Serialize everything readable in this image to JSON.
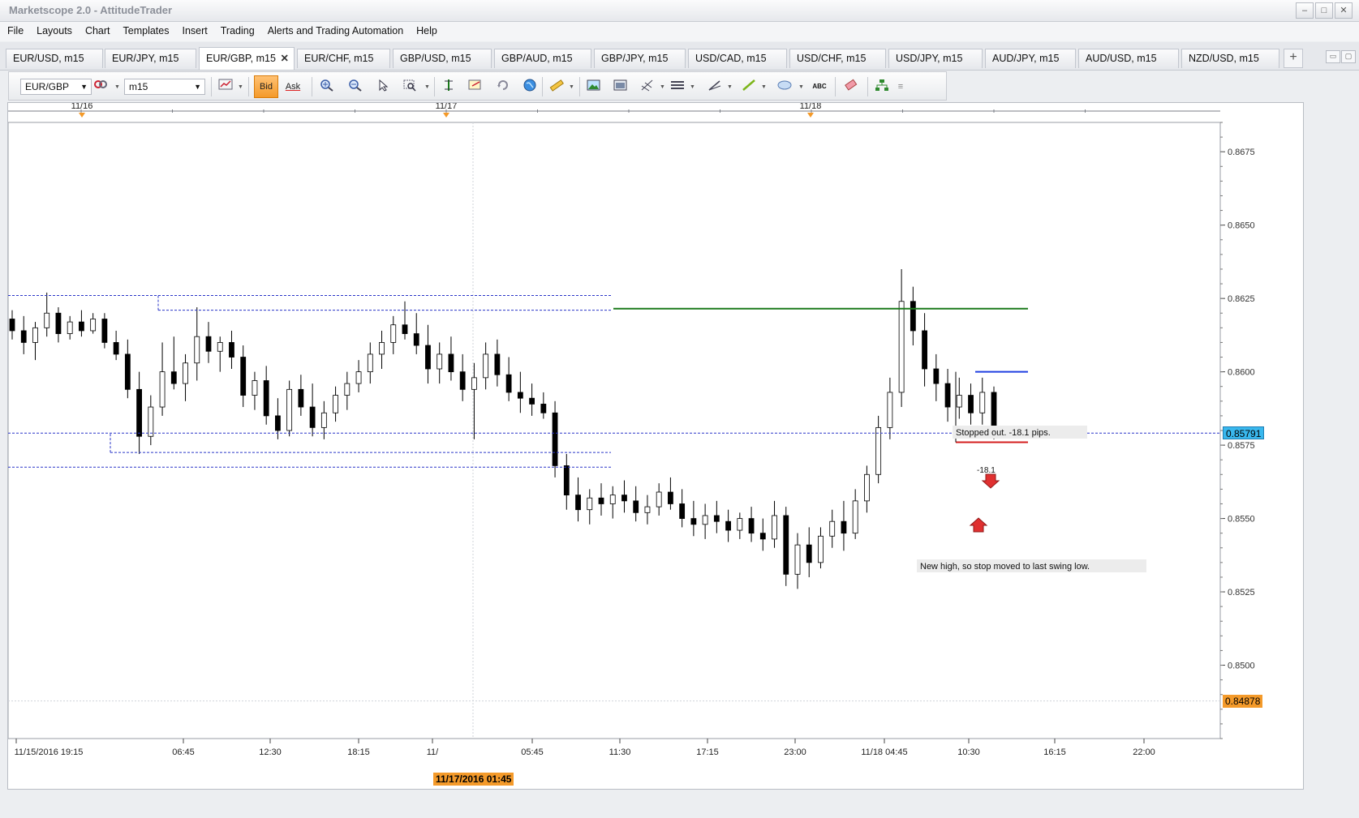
{
  "window": {
    "title": "Marketscope 2.0 - AttitudeTrader",
    "controls": [
      "–",
      "□",
      "✕"
    ]
  },
  "menu": [
    "File",
    "Layouts",
    "Chart",
    "Templates",
    "Insert",
    "Trading",
    "Alerts and Trading Automation",
    "Help"
  ],
  "tabs": [
    {
      "label": "EUR/USD, m15",
      "active": false
    },
    {
      "label": "EUR/JPY, m15",
      "active": false
    },
    {
      "label": "EUR/GBP, m15",
      "active": true
    },
    {
      "label": "EUR/CHF, m15",
      "active": false
    },
    {
      "label": "GBP/USD, m15",
      "active": false
    },
    {
      "label": "GBP/AUD, m15",
      "active": false
    },
    {
      "label": "GBP/JPY, m15",
      "active": false
    },
    {
      "label": "USD/CAD, m15",
      "active": false
    },
    {
      "label": "USD/CHF, m15",
      "active": false
    },
    {
      "label": "USD/JPY, m15",
      "active": false
    },
    {
      "label": "AUD/JPY, m15",
      "active": false
    },
    {
      "label": "AUD/USD, m15",
      "active": false
    },
    {
      "label": "NZD/USD, m15",
      "active": false
    }
  ],
  "tab_close_glyph": "✕",
  "tab_add_glyph": "+",
  "toolbar": {
    "instrument": "EUR/GBP",
    "timeframe": "m15",
    "bid_label": "Bid",
    "ask_label": "Ask",
    "abc_label": "ABC"
  },
  "chart_data": {
    "type": "candlestick",
    "instrument": "EUR/GBP",
    "timeframe": "m15",
    "ylim": [
      0.8475,
      0.8685
    ],
    "y_ticks": [
      "0.8675",
      "0.8650",
      "0.8625",
      "0.8600",
      "0.8575",
      "0.8550",
      "0.8525",
      "0.8500"
    ],
    "y_tick_values": [
      0.8675,
      0.865,
      0.8625,
      0.86,
      0.8575,
      0.855,
      0.8525,
      0.85
    ],
    "date_marks": [
      "11/16",
      "11/17",
      "11/18"
    ],
    "x_ticks": [
      "11/15/2016 19:15",
      "06:45",
      "12:30",
      "18:15",
      "11/",
      "05:45",
      "11:30",
      "17:15",
      "23:00",
      "11/18 04:45",
      "10:30",
      "16:15",
      "22:00"
    ],
    "cursor_time_label": "11/17/2016 01:45",
    "current_price_label": "0.85791",
    "current_price": 0.85791,
    "cursor_price_label": "0.84878",
    "cursor_price": 0.84878,
    "candles": [
      {
        "o": 0.8618,
        "h": 0.8621,
        "l": 0.8611,
        "c": 0.8614
      },
      {
        "o": 0.8614,
        "h": 0.8619,
        "l": 0.8606,
        "c": 0.861
      },
      {
        "o": 0.861,
        "h": 0.8617,
        "l": 0.8604,
        "c": 0.8615
      },
      {
        "o": 0.8615,
        "h": 0.8627,
        "l": 0.8612,
        "c": 0.862
      },
      {
        "o": 0.862,
        "h": 0.8622,
        "l": 0.861,
        "c": 0.8613
      },
      {
        "o": 0.8613,
        "h": 0.8619,
        "l": 0.8611,
        "c": 0.8617
      },
      {
        "o": 0.8617,
        "h": 0.8621,
        "l": 0.8612,
        "c": 0.8614
      },
      {
        "o": 0.8614,
        "h": 0.862,
        "l": 0.8613,
        "c": 0.8618
      },
      {
        "o": 0.8618,
        "h": 0.862,
        "l": 0.8608,
        "c": 0.861
      },
      {
        "o": 0.861,
        "h": 0.8614,
        "l": 0.8604,
        "c": 0.8606
      },
      {
        "o": 0.8606,
        "h": 0.8611,
        "l": 0.8591,
        "c": 0.8594
      },
      {
        "o": 0.8594,
        "h": 0.86,
        "l": 0.8572,
        "c": 0.8578
      },
      {
        "o": 0.8578,
        "h": 0.8592,
        "l": 0.8575,
        "c": 0.8588
      },
      {
        "o": 0.8588,
        "h": 0.861,
        "l": 0.8585,
        "c": 0.86
      },
      {
        "o": 0.86,
        "h": 0.8612,
        "l": 0.8594,
        "c": 0.8596
      },
      {
        "o": 0.8596,
        "h": 0.8606,
        "l": 0.859,
        "c": 0.8603
      },
      {
        "o": 0.8603,
        "h": 0.8622,
        "l": 0.8597,
        "c": 0.8612
      },
      {
        "o": 0.8612,
        "h": 0.8617,
        "l": 0.8603,
        "c": 0.8607
      },
      {
        "o": 0.8607,
        "h": 0.8612,
        "l": 0.86,
        "c": 0.861
      },
      {
        "o": 0.861,
        "h": 0.8614,
        "l": 0.8601,
        "c": 0.8605
      },
      {
        "o": 0.8605,
        "h": 0.8609,
        "l": 0.8588,
        "c": 0.8592
      },
      {
        "o": 0.8592,
        "h": 0.86,
        "l": 0.8587,
        "c": 0.8597
      },
      {
        "o": 0.8597,
        "h": 0.8602,
        "l": 0.8582,
        "c": 0.8585
      },
      {
        "o": 0.8585,
        "h": 0.8591,
        "l": 0.8577,
        "c": 0.858
      },
      {
        "o": 0.858,
        "h": 0.8597,
        "l": 0.8578,
        "c": 0.8594
      },
      {
        "o": 0.8594,
        "h": 0.8599,
        "l": 0.8585,
        "c": 0.8588
      },
      {
        "o": 0.8588,
        "h": 0.8596,
        "l": 0.8578,
        "c": 0.8581
      },
      {
        "o": 0.8581,
        "h": 0.859,
        "l": 0.8577,
        "c": 0.8586
      },
      {
        "o": 0.8586,
        "h": 0.8595,
        "l": 0.8583,
        "c": 0.8592
      },
      {
        "o": 0.8592,
        "h": 0.86,
        "l": 0.8587,
        "c": 0.8596
      },
      {
        "o": 0.8596,
        "h": 0.8604,
        "l": 0.8593,
        "c": 0.86
      },
      {
        "o": 0.86,
        "h": 0.861,
        "l": 0.8596,
        "c": 0.8606
      },
      {
        "o": 0.8606,
        "h": 0.8614,
        "l": 0.8601,
        "c": 0.861
      },
      {
        "o": 0.861,
        "h": 0.8619,
        "l": 0.8606,
        "c": 0.8616
      },
      {
        "o": 0.8616,
        "h": 0.8624,
        "l": 0.8611,
        "c": 0.8613
      },
      {
        "o": 0.8613,
        "h": 0.862,
        "l": 0.8606,
        "c": 0.8609
      },
      {
        "o": 0.8609,
        "h": 0.8616,
        "l": 0.8596,
        "c": 0.8601
      },
      {
        "o": 0.8601,
        "h": 0.861,
        "l": 0.8596,
        "c": 0.8606
      },
      {
        "o": 0.8606,
        "h": 0.8612,
        "l": 0.8597,
        "c": 0.86
      },
      {
        "o": 0.86,
        "h": 0.8606,
        "l": 0.859,
        "c": 0.8594
      },
      {
        "o": 0.8594,
        "h": 0.8603,
        "l": 0.8577,
        "c": 0.8598
      },
      {
        "o": 0.8598,
        "h": 0.861,
        "l": 0.8594,
        "c": 0.8606
      },
      {
        "o": 0.8606,
        "h": 0.8611,
        "l": 0.8595,
        "c": 0.8599
      },
      {
        "o": 0.8599,
        "h": 0.8605,
        "l": 0.859,
        "c": 0.8593
      },
      {
        "o": 0.8593,
        "h": 0.86,
        "l": 0.8586,
        "c": 0.8591
      },
      {
        "o": 0.8591,
        "h": 0.8596,
        "l": 0.8585,
        "c": 0.8589
      },
      {
        "o": 0.8589,
        "h": 0.8593,
        "l": 0.8584,
        "c": 0.8586
      },
      {
        "o": 0.8586,
        "h": 0.859,
        "l": 0.8564,
        "c": 0.8568
      },
      {
        "o": 0.8568,
        "h": 0.8572,
        "l": 0.8553,
        "c": 0.8558
      },
      {
        "o": 0.8558,
        "h": 0.8564,
        "l": 0.8549,
        "c": 0.8553
      },
      {
        "o": 0.8553,
        "h": 0.856,
        "l": 0.8548,
        "c": 0.8557
      },
      {
        "o": 0.8557,
        "h": 0.8562,
        "l": 0.8551,
        "c": 0.8555
      },
      {
        "o": 0.8555,
        "h": 0.8561,
        "l": 0.855,
        "c": 0.8558
      },
      {
        "o": 0.8558,
        "h": 0.8563,
        "l": 0.8552,
        "c": 0.8556
      },
      {
        "o": 0.8556,
        "h": 0.8561,
        "l": 0.8549,
        "c": 0.8552
      },
      {
        "o": 0.8552,
        "h": 0.8558,
        "l": 0.8548,
        "c": 0.8554
      },
      {
        "o": 0.8554,
        "h": 0.8562,
        "l": 0.8551,
        "c": 0.8559
      },
      {
        "o": 0.8559,
        "h": 0.8564,
        "l": 0.8553,
        "c": 0.8555
      },
      {
        "o": 0.8555,
        "h": 0.856,
        "l": 0.8547,
        "c": 0.855
      },
      {
        "o": 0.855,
        "h": 0.8556,
        "l": 0.8544,
        "c": 0.8548
      },
      {
        "o": 0.8548,
        "h": 0.8555,
        "l": 0.8543,
        "c": 0.8551
      },
      {
        "o": 0.8551,
        "h": 0.8556,
        "l": 0.8545,
        "c": 0.8549
      },
      {
        "o": 0.8549,
        "h": 0.8553,
        "l": 0.8542,
        "c": 0.8546
      },
      {
        "o": 0.8546,
        "h": 0.8552,
        "l": 0.8543,
        "c": 0.855
      },
      {
        "o": 0.855,
        "h": 0.8554,
        "l": 0.8542,
        "c": 0.8545
      },
      {
        "o": 0.8545,
        "h": 0.855,
        "l": 0.8539,
        "c": 0.8543
      },
      {
        "o": 0.8543,
        "h": 0.8556,
        "l": 0.854,
        "c": 0.8551
      },
      {
        "o": 0.8551,
        "h": 0.8554,
        "l": 0.8527,
        "c": 0.8531
      },
      {
        "o": 0.8531,
        "h": 0.8545,
        "l": 0.8526,
        "c": 0.8541
      },
      {
        "o": 0.8541,
        "h": 0.8547,
        "l": 0.853,
        "c": 0.8535
      },
      {
        "o": 0.8535,
        "h": 0.8547,
        "l": 0.8533,
        "c": 0.8544
      },
      {
        "o": 0.8544,
        "h": 0.8553,
        "l": 0.854,
        "c": 0.8549
      },
      {
        "o": 0.8549,
        "h": 0.8556,
        "l": 0.8539,
        "c": 0.8545
      },
      {
        "o": 0.8545,
        "h": 0.856,
        "l": 0.8543,
        "c": 0.8556
      },
      {
        "o": 0.8556,
        "h": 0.8568,
        "l": 0.8552,
        "c": 0.8565
      },
      {
        "o": 0.8565,
        "h": 0.8585,
        "l": 0.8562,
        "c": 0.8581
      },
      {
        "o": 0.8581,
        "h": 0.8598,
        "l": 0.8577,
        "c": 0.8593
      },
      {
        "o": 0.8593,
        "h": 0.8635,
        "l": 0.8588,
        "c": 0.8624
      },
      {
        "o": 0.8624,
        "h": 0.8629,
        "l": 0.8609,
        "c": 0.8614
      },
      {
        "o": 0.8614,
        "h": 0.862,
        "l": 0.8595,
        "c": 0.8601
      },
      {
        "o": 0.8601,
        "h": 0.8606,
        "l": 0.859,
        "c": 0.8596
      },
      {
        "o": 0.8596,
        "h": 0.8601,
        "l": 0.8583,
        "c": 0.8588
      },
      {
        "o": 0.8588,
        "h": 0.8598,
        "l": 0.8584,
        "c": 0.8592
      },
      {
        "o": 0.8592,
        "h": 0.8596,
        "l": 0.8582,
        "c": 0.8586
      },
      {
        "o": 0.8586,
        "h": 0.8598,
        "l": 0.8582,
        "c": 0.8593
      },
      {
        "o": 0.8593,
        "h": 0.8595,
        "l": 0.8577,
        "c": 0.8579
      }
    ],
    "levels": [
      {
        "name": "resistance-upper-dotted",
        "price": 0.8626,
        "style": "dotted",
        "color": "#2a36c8"
      },
      {
        "name": "resistance-dotted",
        "price": 0.8621,
        "style": "dotted",
        "color": "#2a36c8"
      },
      {
        "name": "stop-line",
        "price": 0.86215,
        "style": "solid",
        "color": "#1a7a1a"
      },
      {
        "name": "entry-line",
        "price": 0.86,
        "style": "solid",
        "color": "#1f3fe0"
      },
      {
        "name": "current-price-line",
        "price": 0.85791,
        "style": "dotted",
        "color": "#2a36c8"
      },
      {
        "name": "support-dotted",
        "price": 0.85725,
        "style": "dotted",
        "color": "#2a36c8"
      },
      {
        "name": "support-lower-dotted",
        "price": 0.85675,
        "style": "dotted",
        "color": "#2a36c8"
      },
      {
        "name": "red-line-upper",
        "price": 0.8579,
        "style": "solid",
        "color": "#d41c1c"
      },
      {
        "name": "red-line-lower",
        "price": 0.8576,
        "style": "solid",
        "color": "#d41c1c"
      }
    ],
    "annotations": [
      {
        "text": "Stopped out. -18.1 pips."
      },
      {
        "text": "New high, so stop moved to last swing low."
      },
      {
        "text": "-18.1"
      }
    ]
  },
  "colors": {
    "accent_orange": "#f49a2a",
    "price_badge_blue": "#39b8ee",
    "grid_dotted": "#cfd3da",
    "bull_candle": "#ffffff",
    "bear_candle": "#000000"
  },
  "icons": [
    "dropdown-arrow-icon",
    "link-chain-icon",
    "indicator-icon",
    "zoom-in-icon",
    "zoom-out-icon",
    "cursor-icon",
    "zoom-area-icon",
    "crosshair-icon",
    "properties-icon",
    "refresh-icon",
    "globe-icon",
    "ruler-icon",
    "image-icon",
    "screenshot-icon",
    "fibonacci-icon",
    "levels-icon",
    "trendline-icon",
    "line-icon",
    "ellipse-icon",
    "text-icon",
    "eraser-icon",
    "hierarchy-icon",
    "more-icon"
  ]
}
